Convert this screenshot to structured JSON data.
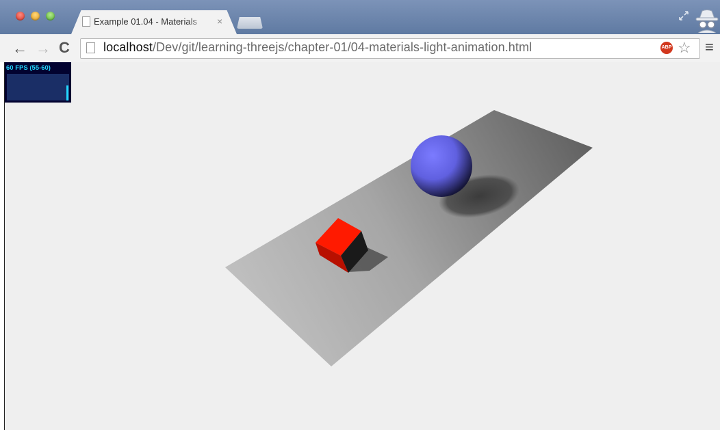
{
  "browser": {
    "tab": {
      "title": "Example 01.04 - Materials",
      "close_glyph": "×"
    },
    "url": {
      "host": "localhost",
      "path": "/Dev/git/learning-threejs/chapter-01/04-materials-light-animation.html"
    },
    "icons": {
      "back": "back-arrow-icon",
      "forward": "forward-arrow-icon",
      "reload": "reload-icon",
      "adblock": "ABP",
      "bookmark": "star-icon",
      "menu": "hamburger-menu-icon"
    },
    "colors": {
      "titlebar": "#6b83a8",
      "toolbar": "#f2f2f2"
    }
  },
  "stats": {
    "label": "60 FPS (55-60)",
    "colors": {
      "text": "#23d8ff",
      "background": "#020230"
    }
  },
  "scene": {
    "objects": [
      "plane",
      "cube",
      "sphere"
    ],
    "colors": {
      "background": "#efefef",
      "plane": "#a6a6a6",
      "cube": "#ff1a00",
      "sphere": "#6b6bef"
    }
  }
}
